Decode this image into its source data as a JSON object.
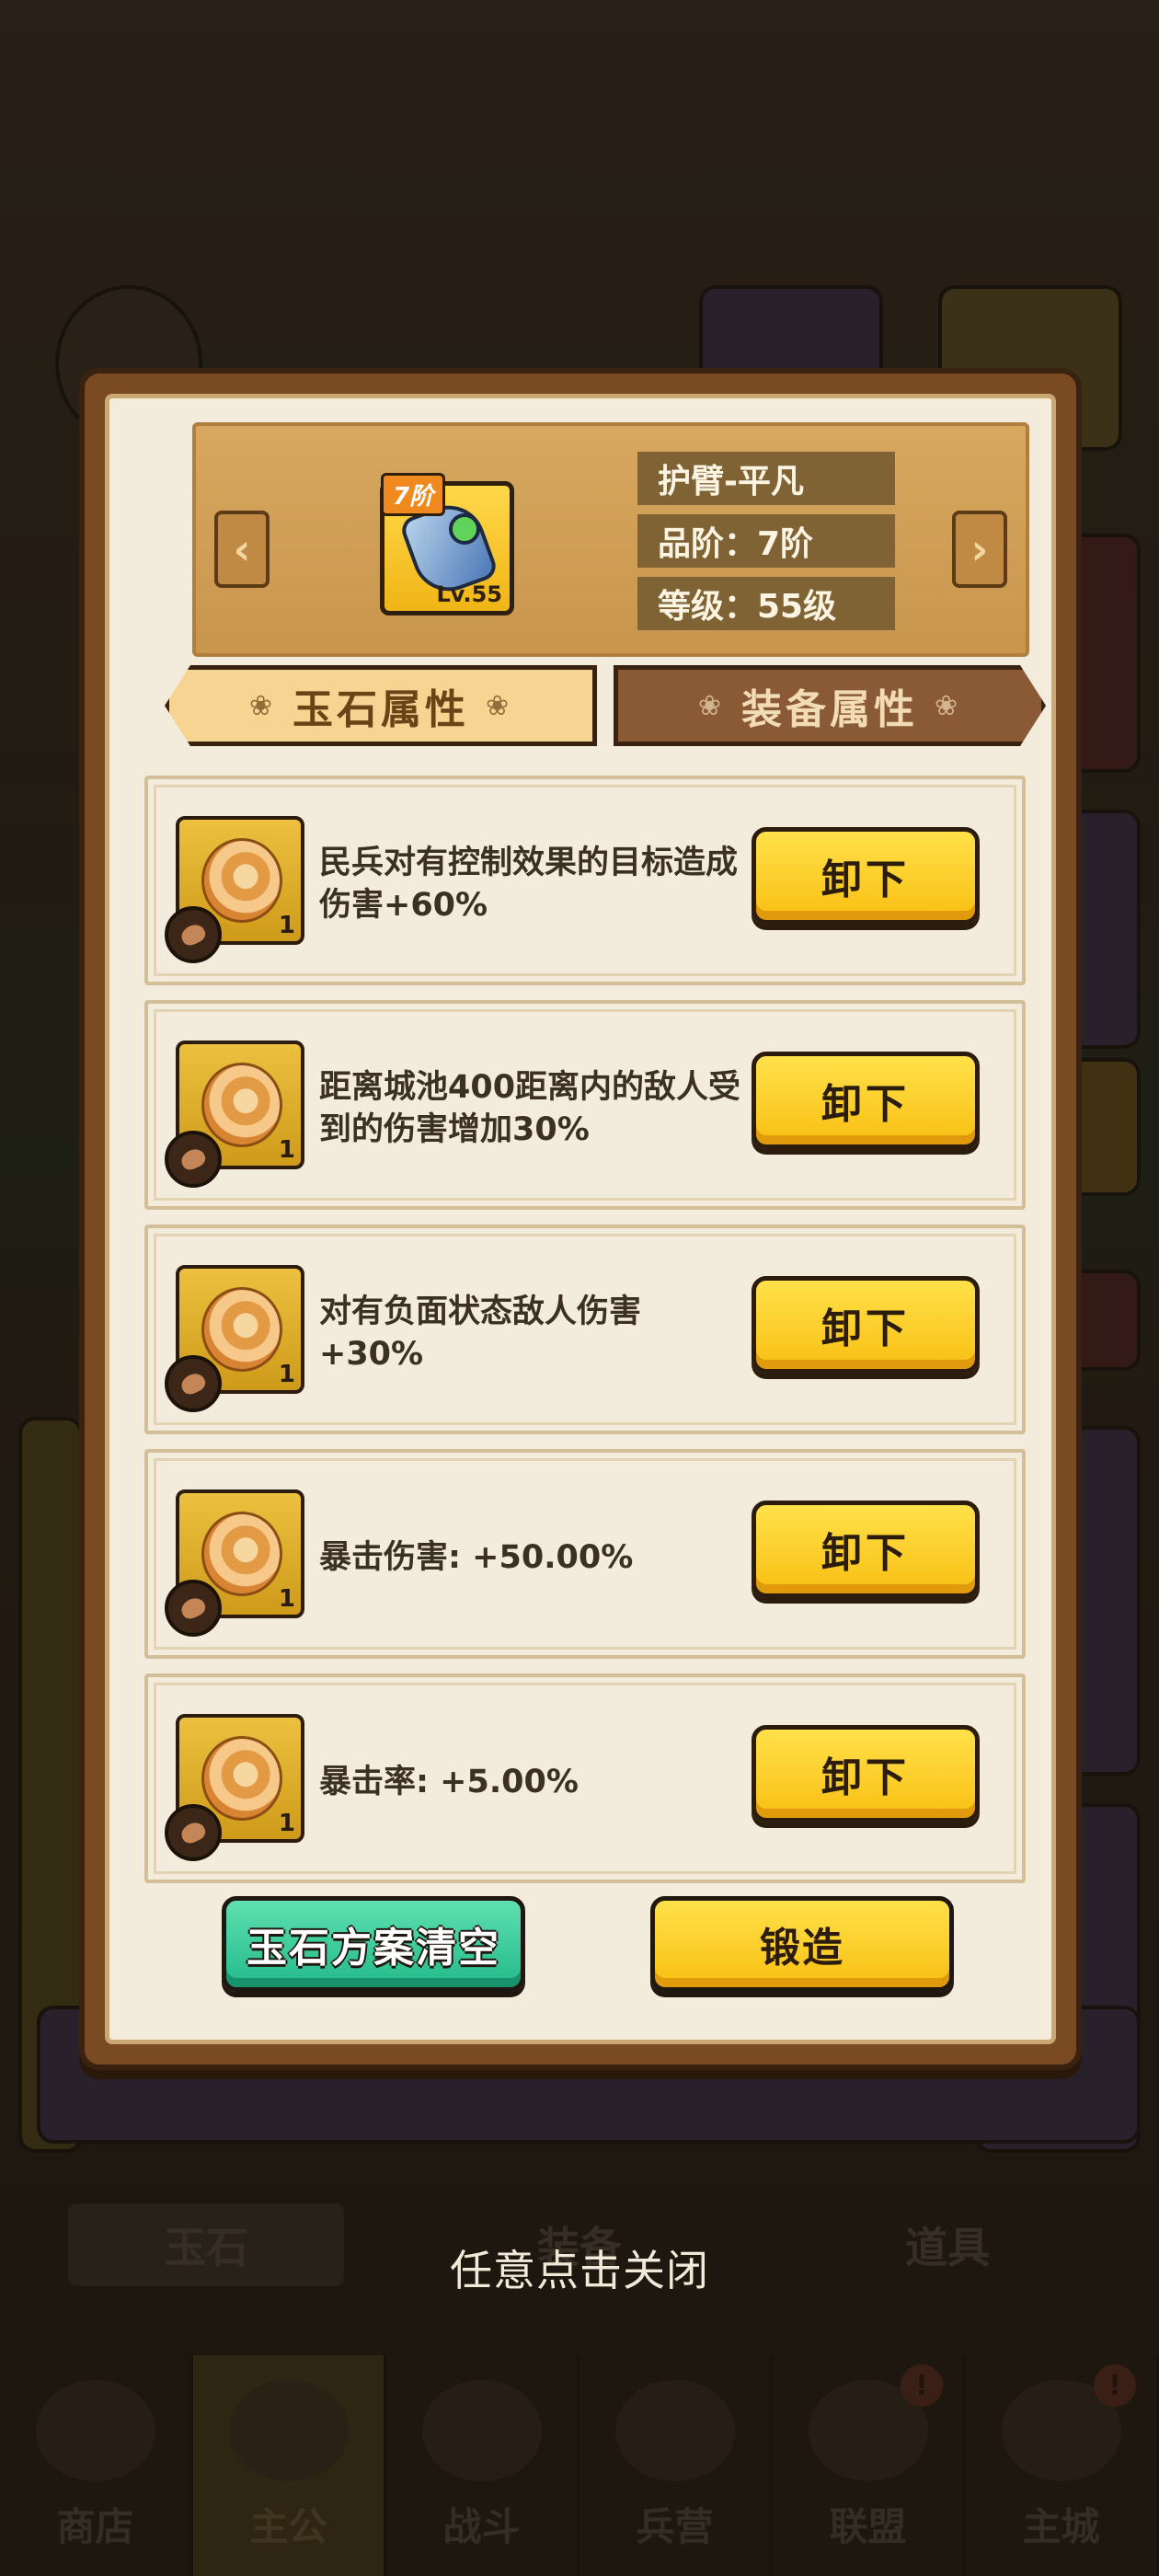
{
  "background": {
    "tabs": [
      {
        "label": "玉石"
      },
      {
        "label": "装备"
      },
      {
        "label": "道具"
      }
    ],
    "bottom_nav": [
      {
        "label": "商店",
        "icon": "shop-icon"
      },
      {
        "label": "主公",
        "icon": "lord-icon",
        "active": true
      },
      {
        "label": "战斗",
        "icon": "battle-icon"
      },
      {
        "label": "兵营",
        "icon": "barracks-icon"
      },
      {
        "label": "联盟",
        "icon": "alliance-icon",
        "badge": "!"
      },
      {
        "label": "主城",
        "icon": "city-icon",
        "badge": "!"
      }
    ]
  },
  "dialog": {
    "equipment": {
      "name": "护臂-平凡",
      "tier_badge": "7阶",
      "level_badge": "Lv.55",
      "quality_line": "品阶：7阶",
      "level_line": "等级：55级",
      "icon": "bracer-icon"
    },
    "nav": {
      "prev": "‹",
      "next": "›"
    },
    "tabs": {
      "jade": "玉石属性",
      "equip": "装备属性",
      "active": "jade"
    },
    "gems": [
      {
        "description": "民兵对有控制效果的目标造成伤害+60%",
        "count": "1",
        "button": "卸下"
      },
      {
        "description": "距离城池400距离内的敌人受到的伤害增加30%",
        "count": "1",
        "button": "卸下"
      },
      {
        "description": "对有负面状态敌人伤害+30%",
        "count": "1",
        "button": "卸下"
      },
      {
        "description": "暴击伤害: +50.00%",
        "count": "1",
        "button": "卸下"
      },
      {
        "description": "暴击率: +5.00%",
        "count": "1",
        "button": "卸下"
      }
    ],
    "actions": {
      "clear": "玉石方案清空",
      "forge": "锻造"
    }
  },
  "close_hint": "任意点击关闭",
  "colors": {
    "frame": "#7a4a22",
    "parchment": "#f3ecdc",
    "button_yellow": "#f8bf12",
    "button_green": "#24b98a"
  }
}
